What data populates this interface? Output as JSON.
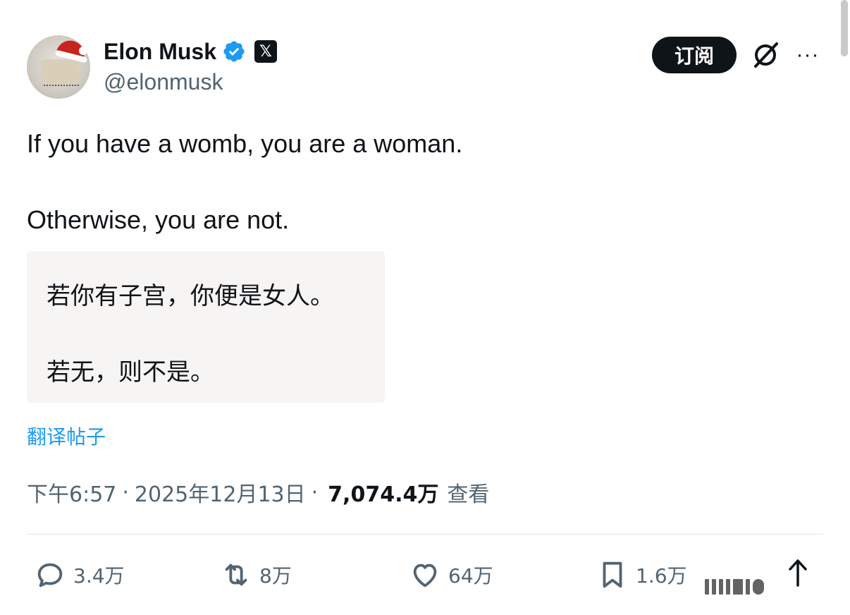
{
  "author": {
    "display_name": "Elon Musk",
    "handle": "@elonmusk",
    "badge_x": "𝕏"
  },
  "header": {
    "subscribe_label": "订阅",
    "more_label": "···"
  },
  "post": {
    "line1": "If you have a womb, you are a woman.",
    "line2": "Otherwise, you are not."
  },
  "translation": {
    "line1": "若你有子宫，你便是女人。",
    "line2": "若无，则不是。",
    "link": "翻译帖子"
  },
  "meta": {
    "time": "下午6:57",
    "separator": "·",
    "date": "2025年12月13日",
    "views_count": "7,074.4万",
    "views_label": "查看"
  },
  "actions": {
    "replies": "3.4万",
    "reposts": "8万",
    "likes": "64万",
    "bookmarks": "1.6万"
  },
  "icons": {
    "verified": "verified-badge-icon",
    "grok": "grok-icon",
    "reply": "reply-icon",
    "repost": "repost-icon",
    "like": "like-icon",
    "bookmark": "bookmark-icon",
    "share": "share-icon"
  },
  "colors": {
    "accent": "#1d9bf0",
    "text": "#0f1419",
    "muted": "#536471"
  }
}
